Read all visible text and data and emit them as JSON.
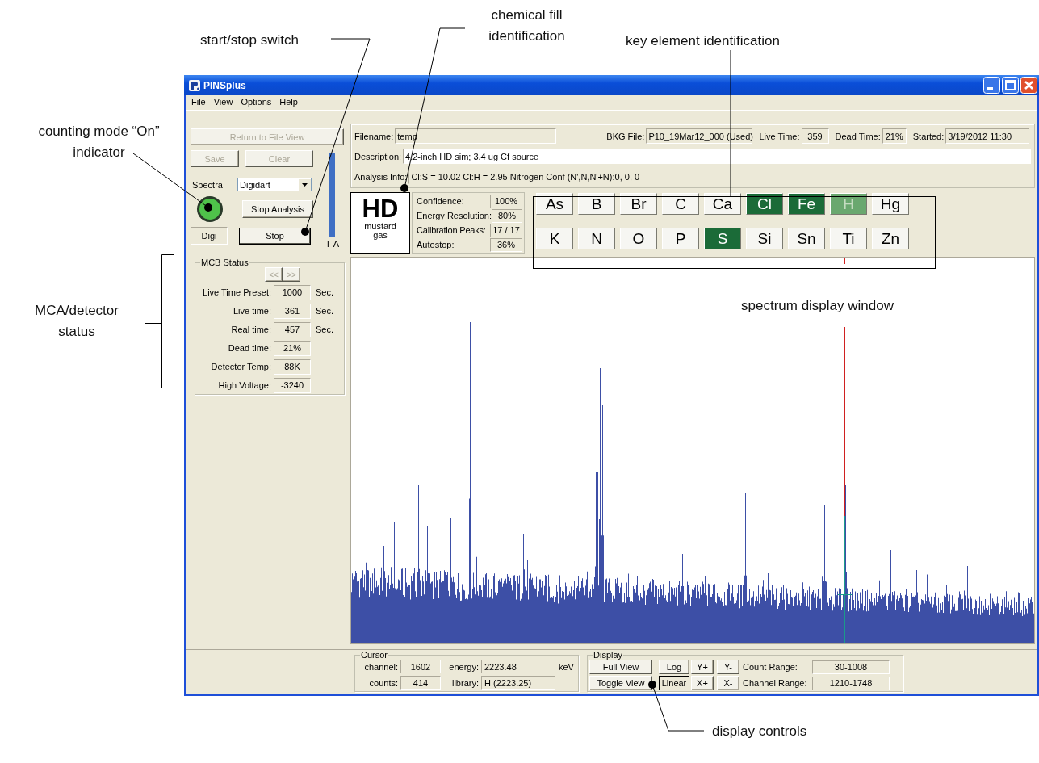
{
  "annotations": [
    {
      "text": "start/stop switch"
    },
    {
      "text": "chemical fill identification"
    },
    {
      "text": "key element identification"
    },
    {
      "text": "counting mode “On” indicator"
    },
    {
      "text": "MCA/detector status"
    },
    {
      "text": "spectrum display window"
    },
    {
      "text": "display controls"
    }
  ],
  "window": {
    "title": "PINSplus"
  },
  "menu": [
    "File",
    "View",
    "Options",
    "Help"
  ],
  "left_panel": {
    "return_button": {
      "label": "Return to File View",
      "disabled": true
    },
    "save_button": {
      "label": "Save",
      "disabled": true
    },
    "clear_button": {
      "label": "Clear",
      "disabled": true
    },
    "spectra_label": "Spectra",
    "spectra_select": "Digidart",
    "counting": true,
    "stop_analysis_button": "Stop Analysis",
    "mode": "Digi",
    "stop_button": "Stop",
    "meter": {
      "level": 0.97
    },
    "meter_labels": [
      "T",
      "A"
    ]
  },
  "mcb_status": {
    "title": "MCB Status",
    "nav_buttons": [
      {
        "label": "<<",
        "disabled": true
      },
      {
        "label": ">>",
        "disabled": true
      }
    ],
    "rows": [
      {
        "label": "Live Time Preset:",
        "value": "1000",
        "unit": "Sec."
      },
      {
        "label": "Live time:",
        "value": "361",
        "unit": "Sec."
      },
      {
        "label": "Real time:",
        "value": "457",
        "unit": "Sec."
      },
      {
        "label": "Dead time:",
        "value": "21%"
      },
      {
        "label": "Detector Temp:",
        "value": "88K"
      },
      {
        "label": "High Voltage:",
        "value": "-3240"
      }
    ]
  },
  "file_info": {
    "filename": {
      "label": "Filename:",
      "value": "temp"
    },
    "bkg_file": {
      "label": "BKG File:",
      "value": "P10_19Mar12_000  (Used)"
    },
    "live_time": {
      "label": "Live Time:",
      "value": "359"
    },
    "dead_time": {
      "label": "Dead Time:",
      "value": "21%"
    },
    "started": {
      "label": "Started:",
      "value": "3/19/2012 11:30"
    },
    "description": {
      "label": "Description:",
      "value": "4.2-inch HD sim; 3.4 ug Cf source"
    },
    "analysis_info": {
      "label": "Analysis Info:",
      "value": "Cl:S = 10.02 Cl:H = 2.95 Nitrogen Conf (N',N,N'+N):0, 0, 0"
    }
  },
  "result": {
    "code": "HD",
    "name": "mustard gas",
    "stats": [
      {
        "label": "Confidence:",
        "value": "100%"
      },
      {
        "label": "Energy Resolution:",
        "value": "80%"
      },
      {
        "label": "Calibration Peaks:",
        "value": "17 / 17"
      },
      {
        "label": "Autostop:",
        "value": "36%"
      }
    ]
  },
  "element_rows": [
    [
      {
        "symbol": "As",
        "detected": false
      },
      {
        "symbol": "B",
        "detected": false
      },
      {
        "symbol": "Br",
        "detected": false
      },
      {
        "symbol": "C",
        "detected": false
      },
      {
        "symbol": "Ca",
        "detected": false
      },
      {
        "symbol": "Cl",
        "detected": true,
        "strong": true
      },
      {
        "symbol": "Fe",
        "detected": true,
        "strong": true
      },
      {
        "symbol": "H",
        "detected": true,
        "strong": false
      },
      {
        "symbol": "Hg",
        "detected": false
      }
    ],
    [
      {
        "symbol": "K",
        "detected": false
      },
      {
        "symbol": "N",
        "detected": false
      },
      {
        "symbol": "O",
        "detected": false
      },
      {
        "symbol": "P",
        "detected": false
      },
      {
        "symbol": "S",
        "detected": true,
        "strong": true
      },
      {
        "symbol": "Si",
        "detected": false
      },
      {
        "symbol": "Sn",
        "detected": false
      },
      {
        "symbol": "Ti",
        "detected": false
      },
      {
        "symbol": "Zn",
        "detected": false
      }
    ]
  ],
  "cursor": {
    "title": "Cursor",
    "fields": [
      {
        "label": "channel:",
        "value": "1602"
      },
      {
        "label": "energy:",
        "value": "2223.48",
        "unit": "keV"
      },
      {
        "label": "counts:",
        "value": "414"
      },
      {
        "label": "library:",
        "value": "H (2223.25)"
      }
    ]
  },
  "display": {
    "title": "Display",
    "view_buttons": [
      "Full View",
      "Toggle View"
    ],
    "scale_buttons": [
      {
        "label": "Log",
        "selected": false
      },
      {
        "label": "Linear",
        "selected": true
      }
    ],
    "zoom_buttons": [
      "Y+",
      "Y-",
      "X+",
      "X-"
    ],
    "ranges": [
      {
        "label": "Count Range:",
        "value": "30-1008"
      },
      {
        "label": "Channel Range:",
        "value": "1210-1748"
      }
    ]
  }
}
